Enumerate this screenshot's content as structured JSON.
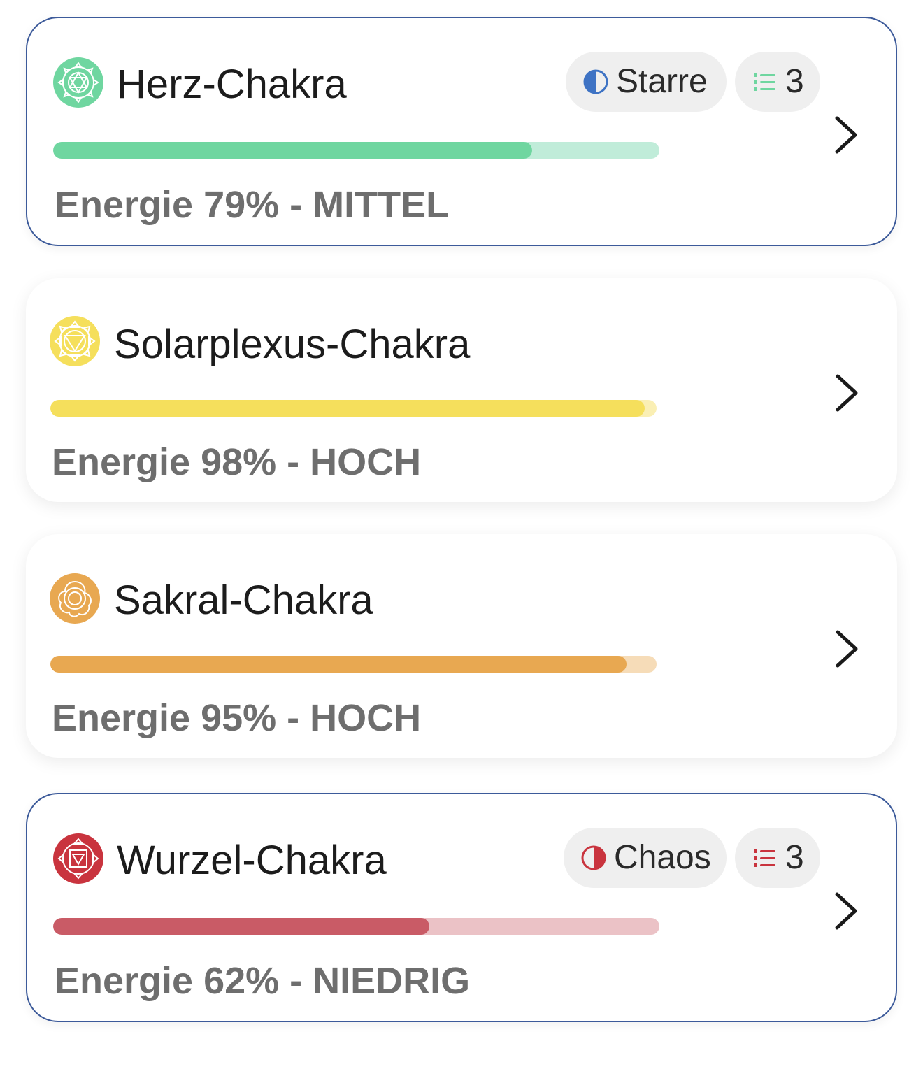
{
  "chakras": [
    {
      "name": "Herz-Chakra",
      "energy_text": "Energie 79% - MITTEL",
      "energy_fraction": 0.79,
      "selected": true,
      "color": "#6fd6a0",
      "track_color": "#c0ecd9",
      "icon": "heart-chakra-icon",
      "state_label": "Starre",
      "state_icon": "half-circle-icon",
      "state_color": "#3e73c4",
      "count": "3",
      "count_icon": "list-icon"
    },
    {
      "name": "Solarplexus-Chakra",
      "energy_text": "Energie 98% - HOCH",
      "energy_fraction": 0.98,
      "selected": false,
      "color": "#f5df5c",
      "track_color": "#faefb4",
      "icon": "solar-plexus-chakra-icon"
    },
    {
      "name": "Sakral-Chakra",
      "energy_text": "Energie 95% - HOCH",
      "energy_fraction": 0.95,
      "selected": false,
      "color": "#e8a851",
      "track_color": "#f6dcb8",
      "icon": "sacral-chakra-icon"
    },
    {
      "name": "Wurzel-Chakra",
      "energy_text": "Energie 62% - NIEDRIG",
      "energy_fraction": 0.62,
      "selected": true,
      "color": "#c95b66",
      "track_color": "#ebc2c6",
      "icon": "root-chakra-icon",
      "state_label": "Chaos",
      "state_icon": "half-circle-icon",
      "state_color": "#c9343e",
      "count": "3",
      "count_icon": "list-icon"
    }
  ],
  "chevron_icon": "chevron-right-icon"
}
